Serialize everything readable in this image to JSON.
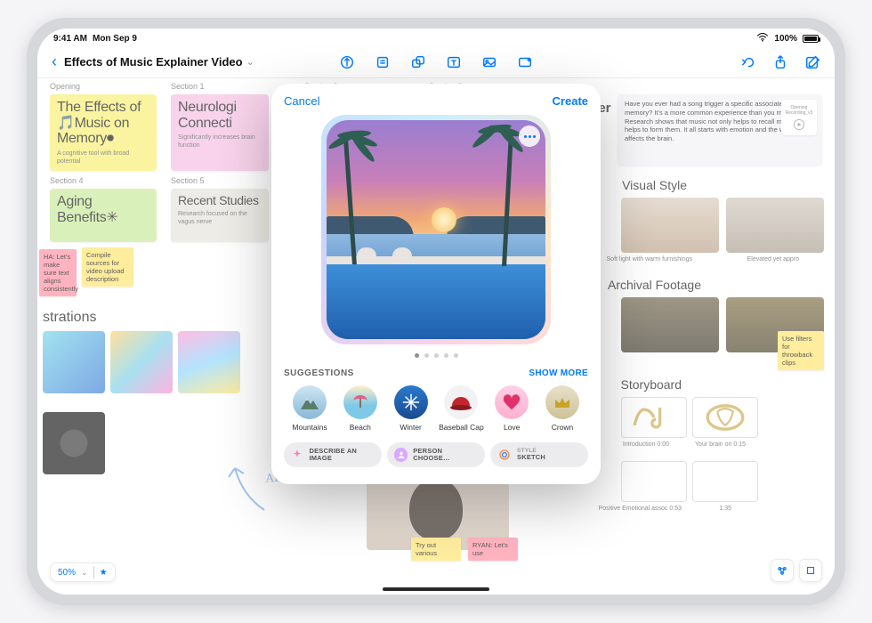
{
  "status": {
    "time": "9:41 AM",
    "date": "Mon Sep 9",
    "battery": "100%"
  },
  "toolbar": {
    "title": "Effects of Music Explainer Video"
  },
  "sections": {
    "opening": "Opening",
    "s1": "Section 1",
    "s2": "Section 2",
    "s3": "Section 3",
    "s4": "Section 4",
    "s5": "Section 5"
  },
  "cards": {
    "opening": {
      "title": "The Effects of 🎵Music on Memory⏺",
      "sub": "A cognitive tool with broad potential"
    },
    "s1": {
      "title": "Neurologi\nConnecti",
      "sub": "Significantly increases brain function"
    },
    "s4": {
      "title": "Aging Benefits✳",
      "sub": ""
    },
    "s5": {
      "title": "Recent Studies",
      "sub": "Research focused on the vagus nerve"
    }
  },
  "stickies": {
    "ha": "HA: Let's make sure text aligns consistently",
    "compile": "Compile sources for video upload description",
    "filters": "Use filters for throwback clips",
    "tryout": "Try out various",
    "ryan": "RYAN: Let's use"
  },
  "headings": {
    "illustrations": "strations",
    "visual_style": "Visual Style",
    "archival": "Archival Footage",
    "storyboard": "Storyboard"
  },
  "visual_style": {
    "cap1": "Soft light with warm furnishings",
    "cap2": "Elevated yet appro"
  },
  "storyboard": {
    "cap1": "Introduction 0:00",
    "cap2": "Your brain on 0:15",
    "cap3": "Positive Emotional assoc 0:53",
    "cap4": "1:35"
  },
  "note": {
    "title": "ver",
    "body": "Have you ever had a song trigger a specific associated memory? It's a more common experience than you might think. Research shows that music not only helps to recall memories, it helps to form them. It all starts with emotion and the way music affects the brain.",
    "clip": "Opening Recording_v3"
  },
  "handwriting": "ADD\nNEW\nIDEAS",
  "zoom": {
    "level": "50%"
  },
  "popover": {
    "cancel": "Cancel",
    "create": "Create",
    "suggestions_label": "SUGGESTIONS",
    "show_more": "SHOW MORE",
    "items": [
      {
        "label": "Mountains"
      },
      {
        "label": "Beach"
      },
      {
        "label": "Winter"
      },
      {
        "label": "Baseball Cap"
      },
      {
        "label": "Love"
      },
      {
        "label": "Crown"
      }
    ],
    "chips": {
      "describe": "DESCRIBE AN IMAGE",
      "person": "PERSON CHOOSE…",
      "style_label": "STYLE",
      "style_value": "SKETCH"
    }
  }
}
